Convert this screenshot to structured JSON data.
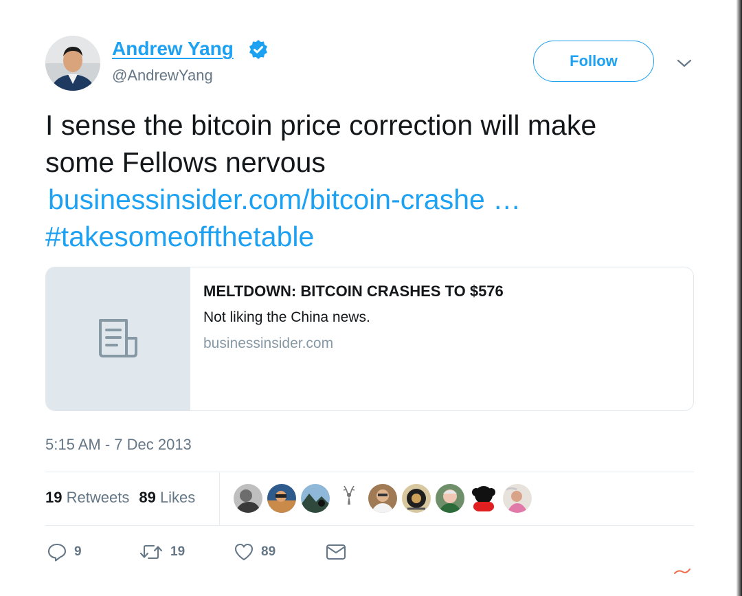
{
  "author": {
    "name": "Andrew Yang",
    "handle": "@AndrewYang",
    "verified_icon": "verified-badge-icon"
  },
  "follow_label": "Follow",
  "tweet": {
    "line1": "I sense the bitcoin price correction will make",
    "line2": "some Fellows nervous",
    "link": "businessinsider.com/bitcoin-crashe …",
    "hashtag": "#takesomeoffthetable"
  },
  "card": {
    "title": "MELTDOWN: BITCOIN CRASHES TO $576",
    "description": "Not liking the China news.",
    "domain": "businessinsider.com",
    "icon": "document-icon"
  },
  "timestamp": "5:15 AM - 7 Dec 2013",
  "stats": {
    "retweets_count": "19",
    "retweets_label": "Retweets",
    "likes_count": "89",
    "likes_label": "Likes"
  },
  "actions": {
    "replies": "9",
    "retweets": "19",
    "likes": "89"
  },
  "colors": {
    "accent": "#1da1f2",
    "secondary_text": "#657786",
    "border": "#e1e8ed"
  }
}
